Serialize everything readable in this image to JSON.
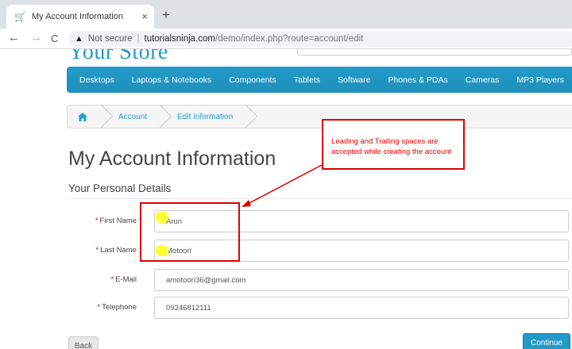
{
  "browser": {
    "tab_title": "My Account Information",
    "tab_close": "×",
    "new_tab": "+",
    "back": "←",
    "forward": "→",
    "reload": "C",
    "warning_icon": "▲",
    "not_secure": "Not secure",
    "separator": "|",
    "url_host": "tutorialsninja.com",
    "url_path": "/demo/index.php?route=account/edit"
  },
  "store": {
    "logo": "Your Store"
  },
  "menu": {
    "items": [
      "Desktops",
      "Laptops & Notebooks",
      "Components",
      "Tablets",
      "Software",
      "Phones & PDAs",
      "Cameras",
      "MP3 Players"
    ]
  },
  "breadcrumb": {
    "home_icon": "home-icon",
    "items": [
      "Account",
      "Edit Information"
    ]
  },
  "annotation": {
    "text": "Leading and Trailing spaces are accepted while creating the account"
  },
  "page": {
    "title": "My Account Information",
    "section": "Your Personal Details"
  },
  "form": {
    "required_mark": "*",
    "fields": [
      {
        "label": "First Name",
        "value": "Arun"
      },
      {
        "label": "Last Name",
        "value": "Motoori"
      },
      {
        "label": "E-Mail",
        "value": "amotoori36@gmail.com"
      },
      {
        "label": "Telephone",
        "value": "09246812111"
      }
    ]
  },
  "buttons": {
    "back": "Back",
    "continue": "Continue"
  },
  "colors": {
    "accent": "#229ac8",
    "annotation": "#e00000",
    "highlight": "#ffff33"
  }
}
